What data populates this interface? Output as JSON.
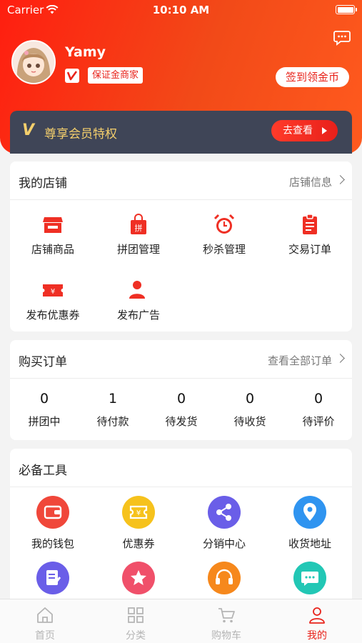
{
  "status_bar": {
    "carrier": "Carrier",
    "time": "10:10 AM"
  },
  "profile": {
    "username": "Yamy",
    "tag": "保证金商家",
    "checkin_label": "签到领金币"
  },
  "vip": {
    "v_mark": "V",
    "text": "尊享会员特权",
    "button": "去查看"
  },
  "shop": {
    "title": "我的店铺",
    "link": "店铺信息",
    "items": [
      {
        "label": "店铺商品",
        "icon": "store-icon"
      },
      {
        "label": "拼团管理",
        "icon": "group-buy-bag-icon"
      },
      {
        "label": "秒杀管理",
        "icon": "alarm-clock-icon"
      },
      {
        "label": "交易订单",
        "icon": "clipboard-icon"
      },
      {
        "label": "发布优惠券",
        "icon": "coupon-icon"
      },
      {
        "label": "发布广告",
        "icon": "user-share-icon"
      }
    ]
  },
  "orders": {
    "title": "购买订单",
    "link": "查看全部订单",
    "items": [
      {
        "count": "0",
        "label": "拼团中"
      },
      {
        "count": "1",
        "label": "待付款"
      },
      {
        "count": "0",
        "label": "待发货"
      },
      {
        "count": "0",
        "label": "待收货"
      },
      {
        "count": "0",
        "label": "待评价"
      }
    ]
  },
  "tools": {
    "title": "必备工具",
    "items": [
      {
        "label": "我的钱包",
        "icon": "wallet-icon",
        "color": "#f0473a"
      },
      {
        "label": "优惠券",
        "icon": "ticket-icon",
        "color": "#f6c21c"
      },
      {
        "label": "分销中心",
        "icon": "share-icon",
        "color": "#6a5ee8"
      },
      {
        "label": "收货地址",
        "icon": "location-pin-icon",
        "color": "#2f94f0"
      },
      {
        "label": "",
        "icon": "edit-note-icon",
        "color": "#6a5ee8"
      },
      {
        "label": "",
        "icon": "star-icon",
        "color": "#f0506a"
      },
      {
        "label": "",
        "icon": "headset-icon",
        "color": "#f6881c"
      },
      {
        "label": "",
        "icon": "chat-bubble-icon",
        "color": "#22c7b5"
      }
    ]
  },
  "tabbar": {
    "tabs": [
      {
        "label": "首页",
        "icon": "home-icon"
      },
      {
        "label": "分类",
        "icon": "grid-icon"
      },
      {
        "label": "购物车",
        "icon": "cart-icon"
      },
      {
        "label": "我的",
        "icon": "user-icon",
        "active": true
      }
    ]
  },
  "colors": {
    "brand": "#e8231b",
    "vip_gold": "#f4cf6c",
    "vip_bg": "#3f4557"
  }
}
